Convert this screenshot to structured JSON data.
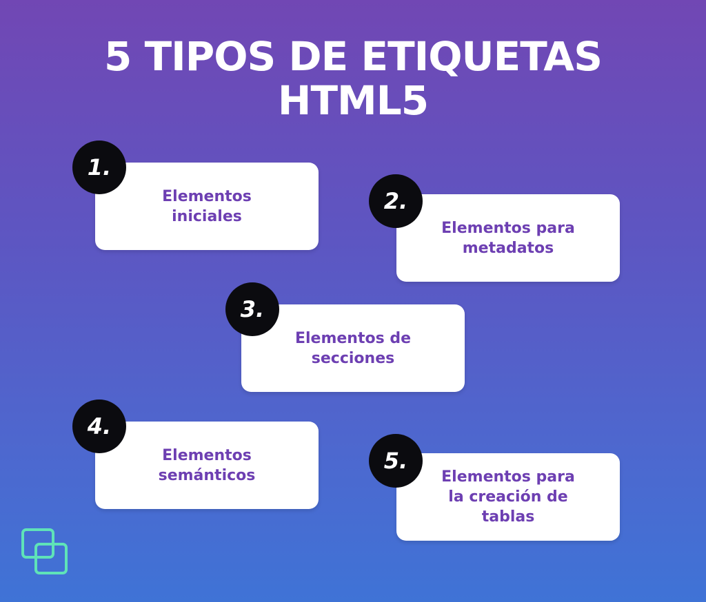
{
  "title": {
    "line1": "5 TIPOS DE ETIQUETAS",
    "line2": "HTML5"
  },
  "items": [
    {
      "number": "1.",
      "label": "Elementos iniciales"
    },
    {
      "number": "2.",
      "label": "Elementos para metadatos"
    },
    {
      "number": "3.",
      "label": "Elementos de secciones"
    },
    {
      "number": "4.",
      "label": "Elementos semánticos"
    },
    {
      "number": "5.",
      "label": "Elementos para la creación de tablas"
    }
  ],
  "colors": {
    "background_top": "#7147b4",
    "background_bottom": "#3f73d6",
    "card_text": "#6d3fb2",
    "badge": "#0b0b0f",
    "logo": "#5fe3b8"
  },
  "icons": {
    "logo": "overlapping-squares-logo-icon"
  }
}
